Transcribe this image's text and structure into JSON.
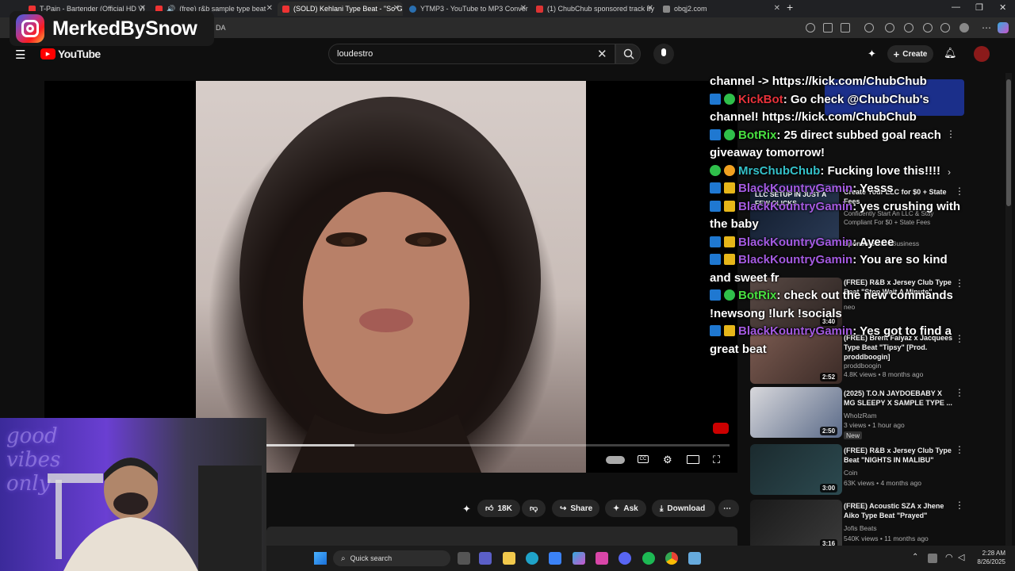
{
  "browser": {
    "tabs": [
      {
        "label": "T-Pain - Bartender (Official HD Vi"
      },
      {
        "label": "(free) r&b sample type beat"
      },
      {
        "label": "(SOLD) Kehlani Type Beat - \"So G"
      },
      {
        "label": "YTMP3 - YouTube to MP3 Conver"
      },
      {
        "label": "(1) ChubChub sponsored track by"
      },
      {
        "label": "obqj2.com"
      }
    ],
    "address_fragment": "DA"
  },
  "youtube": {
    "logo_text": "YouTube",
    "search_value": "loudestro",
    "create_label": "Create"
  },
  "player": {
    "progress_fraction": 0.19
  },
  "actions": {
    "like_count": "18K",
    "share_label": "Share",
    "ask_label": "Ask",
    "download_label": "Download"
  },
  "chat": [
    {
      "user": "",
      "text": "channel -> https://kick.com/ChubChub",
      "user_color": "#ffffff"
    },
    {
      "user": "KickBot",
      "text": ": Go check @ChubChub's channel! https://kick.com/ChubChub",
      "user_color": "#e8323a"
    },
    {
      "user": "BotRix",
      "text": ": 25 direct subbed goal reach giveaway tomorrow!",
      "user_color": "#48e040"
    },
    {
      "user": "MrsChubChub",
      "text": ": Fucking love this!!!!",
      "user_color": "#34c0c8"
    },
    {
      "user": "BlackKountryGamin",
      "text": ": Yesss",
      "user_color": "#a45ae0"
    },
    {
      "user": "BlackKountryGamin",
      "text": ": yes crushing with the baby",
      "user_color": "#a45ae0"
    },
    {
      "user": "BlackKountryGamin",
      "text": ": Ayeee",
      "user_color": "#a45ae0"
    },
    {
      "user": "BlackKountryGamin",
      "text": ": You are so kind and sweet fr",
      "user_color": "#a45ae0"
    },
    {
      "user": "BotRix",
      "text": ": check out the new commands !newsong !lurk !socials",
      "user_color": "#48e040"
    },
    {
      "user": "BlackKountryGamin",
      "text": ": Yes got to find a great beat",
      "user_color": "#a45ae0"
    }
  ],
  "sidebar": {
    "ad": {
      "sponsored_label": "Sponsored",
      "title": "Create Your LLC for $0 + State Fees",
      "desc": "Confidently Start An LLC & Stay Compliant For $0 + State Fees",
      "advertiser": "ZenBusiness",
      "thumb_caption": "LLC SETUP IN JUST A FEW CLICKS"
    },
    "items": [
      {
        "title": "(FREE) R&B x Jersey Club Type Beat \"Stop Wait A Minute\"",
        "channel": "neo",
        "meta": "",
        "duration": "3:40"
      },
      {
        "title": "(FREE) Brent Faiyaz x Jacquees Type Beat \"Tipsy\" [Prod. proddboogin]",
        "channel": "proddboogin",
        "meta": "4.8K views • 8 months ago",
        "duration": "2:52"
      },
      {
        "title": "(2025) T.O.N JAYDOEBABY X MG SLEEPY X SAMPLE TYPE ...",
        "channel": "WholzRam",
        "meta": "3 views • 1 hour ago",
        "badge": "New",
        "duration": "2:50"
      },
      {
        "title": "(FREE) R&B x Jersey Club Type Beat \"NIGHTS IN MALIBU\"",
        "channel": "Coin",
        "meta": "63K views • 4 months ago",
        "duration": "3:00"
      },
      {
        "title": "(FREE) Acoustic SZA x Jhene Aiko Type Beat \"Prayed\"",
        "channel": "Jofis Beats",
        "meta": "540K views • 11 months ago",
        "duration": "3:16"
      }
    ]
  },
  "overlay": {
    "instagram_handle": "MerkedBySnow",
    "neon_text": "good vibes only"
  },
  "taskbar": {
    "search_placeholder": "Quick search",
    "time": "2:28 AM",
    "date": "8/26/2025"
  }
}
